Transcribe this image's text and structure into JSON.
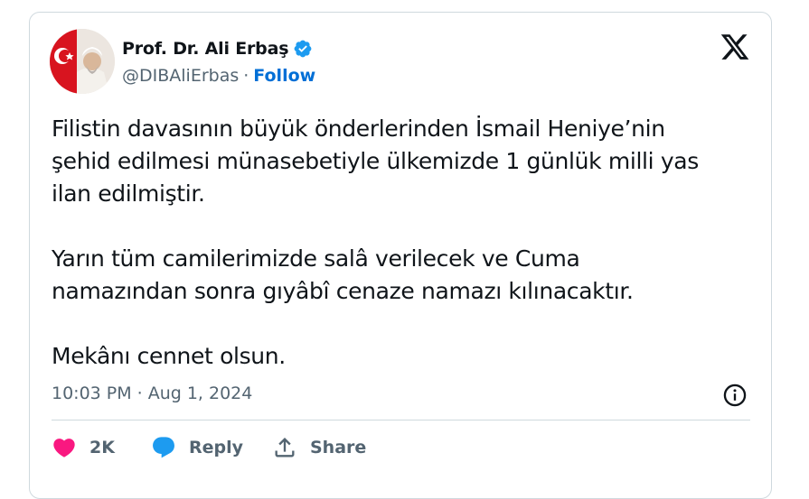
{
  "tweet": {
    "author": {
      "display_name": "Prof. Dr. Ali Erbaş",
      "handle": "@DIBAliErbas",
      "separator": "·",
      "follow_label": "Follow",
      "verified": true,
      "verified_color": "#1d9bf0"
    },
    "platform_icon": "x-logo-icon",
    "body": {
      "paragraph_1": [
        "Filistin davasının büyük önderlerinden İsmail Heniye’nin",
        "şehid edilmesi münasebetiyle ülkemizde 1 günlük milli yas",
        "ilan edilmiştir."
      ],
      "paragraph_2": [
        "Yarın tüm camilerimizde salâ verilecek ve Cuma",
        "namazından sonra gıyâbî cenaze namazı kılınacaktır."
      ],
      "paragraph_3": [
        "Mekânı cennet olsun."
      ]
    },
    "time": "10:03 PM",
    "date_separator": "·",
    "date": "Aug 1, 2024",
    "actions": {
      "like_count": "2K",
      "reply_label": "Reply",
      "share_label": "Share"
    },
    "colors": {
      "like": "#f91880",
      "reply": "#1d9bf0",
      "muted_text": "#536471",
      "follow": "#006fd6"
    }
  }
}
